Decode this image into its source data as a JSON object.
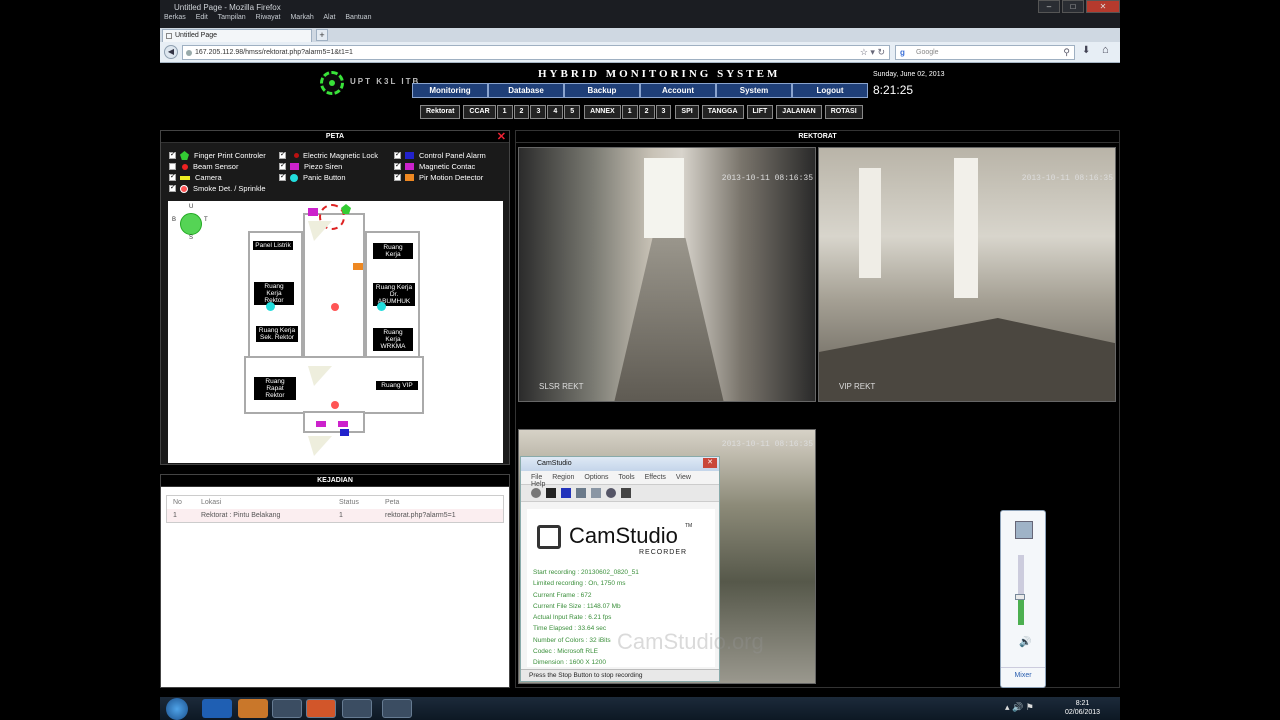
{
  "window": {
    "title": "Untitled Page - Mozilla Firefox",
    "menu": [
      "Berkas",
      "Edit",
      "Tampilan",
      "Riwayat",
      "Markah",
      "Alat",
      "Bantuan"
    ]
  },
  "browser": {
    "tab_title": "Untitled Page",
    "new_tab": "+",
    "url": "167.205.112.98/hmss/rektorat.php?alarm5=1&t1=1",
    "search_placeholder": "Google"
  },
  "header": {
    "brand": "UPT K3L ITB",
    "system_title": "HYBRID MONITORING SYSTEM",
    "date": "Sunday, June 02, 2013",
    "time": "8:21:25",
    "nav": [
      "Monitoring",
      "Database",
      "Backup",
      "Account",
      "System",
      "Logout"
    ]
  },
  "subnav": {
    "rektorat": "Rektorat",
    "ccar": "CCAR",
    "ccar_nums": [
      "1",
      "2",
      "3",
      "4",
      "5"
    ],
    "annex": "ANNEX",
    "annex_nums": [
      "1",
      "2",
      "3"
    ],
    "spi": "SPI",
    "tangga": "TANGGA",
    "lift": "LIFT",
    "jalanan": "JALANAN",
    "rotasi": "ROTASI"
  },
  "peta": {
    "title": "PETA",
    "legend": [
      {
        "label": "Finger Print Controler",
        "checked": true
      },
      {
        "label": "Beam Sensor",
        "checked": false
      },
      {
        "label": "Camera",
        "checked": true
      },
      {
        "label": "Smoke Det. / Sprinkle",
        "checked": true
      },
      {
        "label": "Electric Magnetic Lock",
        "checked": true
      },
      {
        "label": "Piezo Siren",
        "checked": true
      },
      {
        "label": "Panic Button",
        "checked": true
      },
      {
        "label": "Control Panel Alarm",
        "checked": true
      },
      {
        "label": "Magnetic Contac",
        "checked": true
      },
      {
        "label": "Pir Motion Detector",
        "checked": true
      }
    ],
    "rooms": {
      "panel_listrik": "Panel Listrik",
      "ruang_kerja": "Ruang Kerja",
      "ruang_kerja_rektor": "Ruang Kerja Rektor",
      "ruang_kerja_dr": "Ruang Kerja Dr. ABUMHUK",
      "ruang_kerja_sek": "Ruang Kerja Sek. Rektor",
      "ruang_kerja_wrkma": "Ruang Kerja WRKMA",
      "ruang_rapat": "Ruang Rapat Rektor",
      "ruang_vip": "Ruang VIP"
    },
    "compass": {
      "u": "U",
      "t": "T",
      "s": "S",
      "b": "B"
    }
  },
  "kejadian": {
    "title": "KEJADIAN",
    "columns": [
      "No",
      "Lokasi",
      "Status",
      "Peta"
    ],
    "rows": [
      [
        "1",
        "Rektorat : Pintu Belakang",
        "1",
        "rektorat.php?alarm5=1"
      ]
    ]
  },
  "rektorat": {
    "title": "REKTORAT",
    "cams": [
      {
        "ts": "2013-10-11 08:16:35",
        "label": "SLSR REKT"
      },
      {
        "ts": "2013-10-11 08:16:35",
        "label": "VIP REKT"
      },
      {
        "ts": "2013-10-11 08:16:35",
        "label": ""
      }
    ]
  },
  "camstudio": {
    "title": "CamStudio",
    "menu": [
      "File",
      "Region",
      "Options",
      "Tools",
      "Effects",
      "View",
      "Help"
    ],
    "name": "CamStudio",
    "tm": "TM",
    "recorder": "RECORDER",
    "info": [
      "Start recording : 20130602_0820_51",
      "Limited recording : On, 1750 ms",
      "Current Frame : 672",
      "Current File Size : 1148.07 Mb",
      "Actual Input Rate : 6.21 fps",
      "Time Elapsed : 33.64 sec",
      "Number of Colors : 32 iBits",
      "Codec : Microsoft RLE",
      "Dimension : 1600 X 1200"
    ],
    "footer": "Press the Stop Button to stop recording",
    "watermark": "CamStudio.org"
  },
  "volume": {
    "mixer": "Mixer",
    "level": 0.4
  },
  "taskbar": {
    "time": "8:21",
    "date": "02/06/2013"
  }
}
